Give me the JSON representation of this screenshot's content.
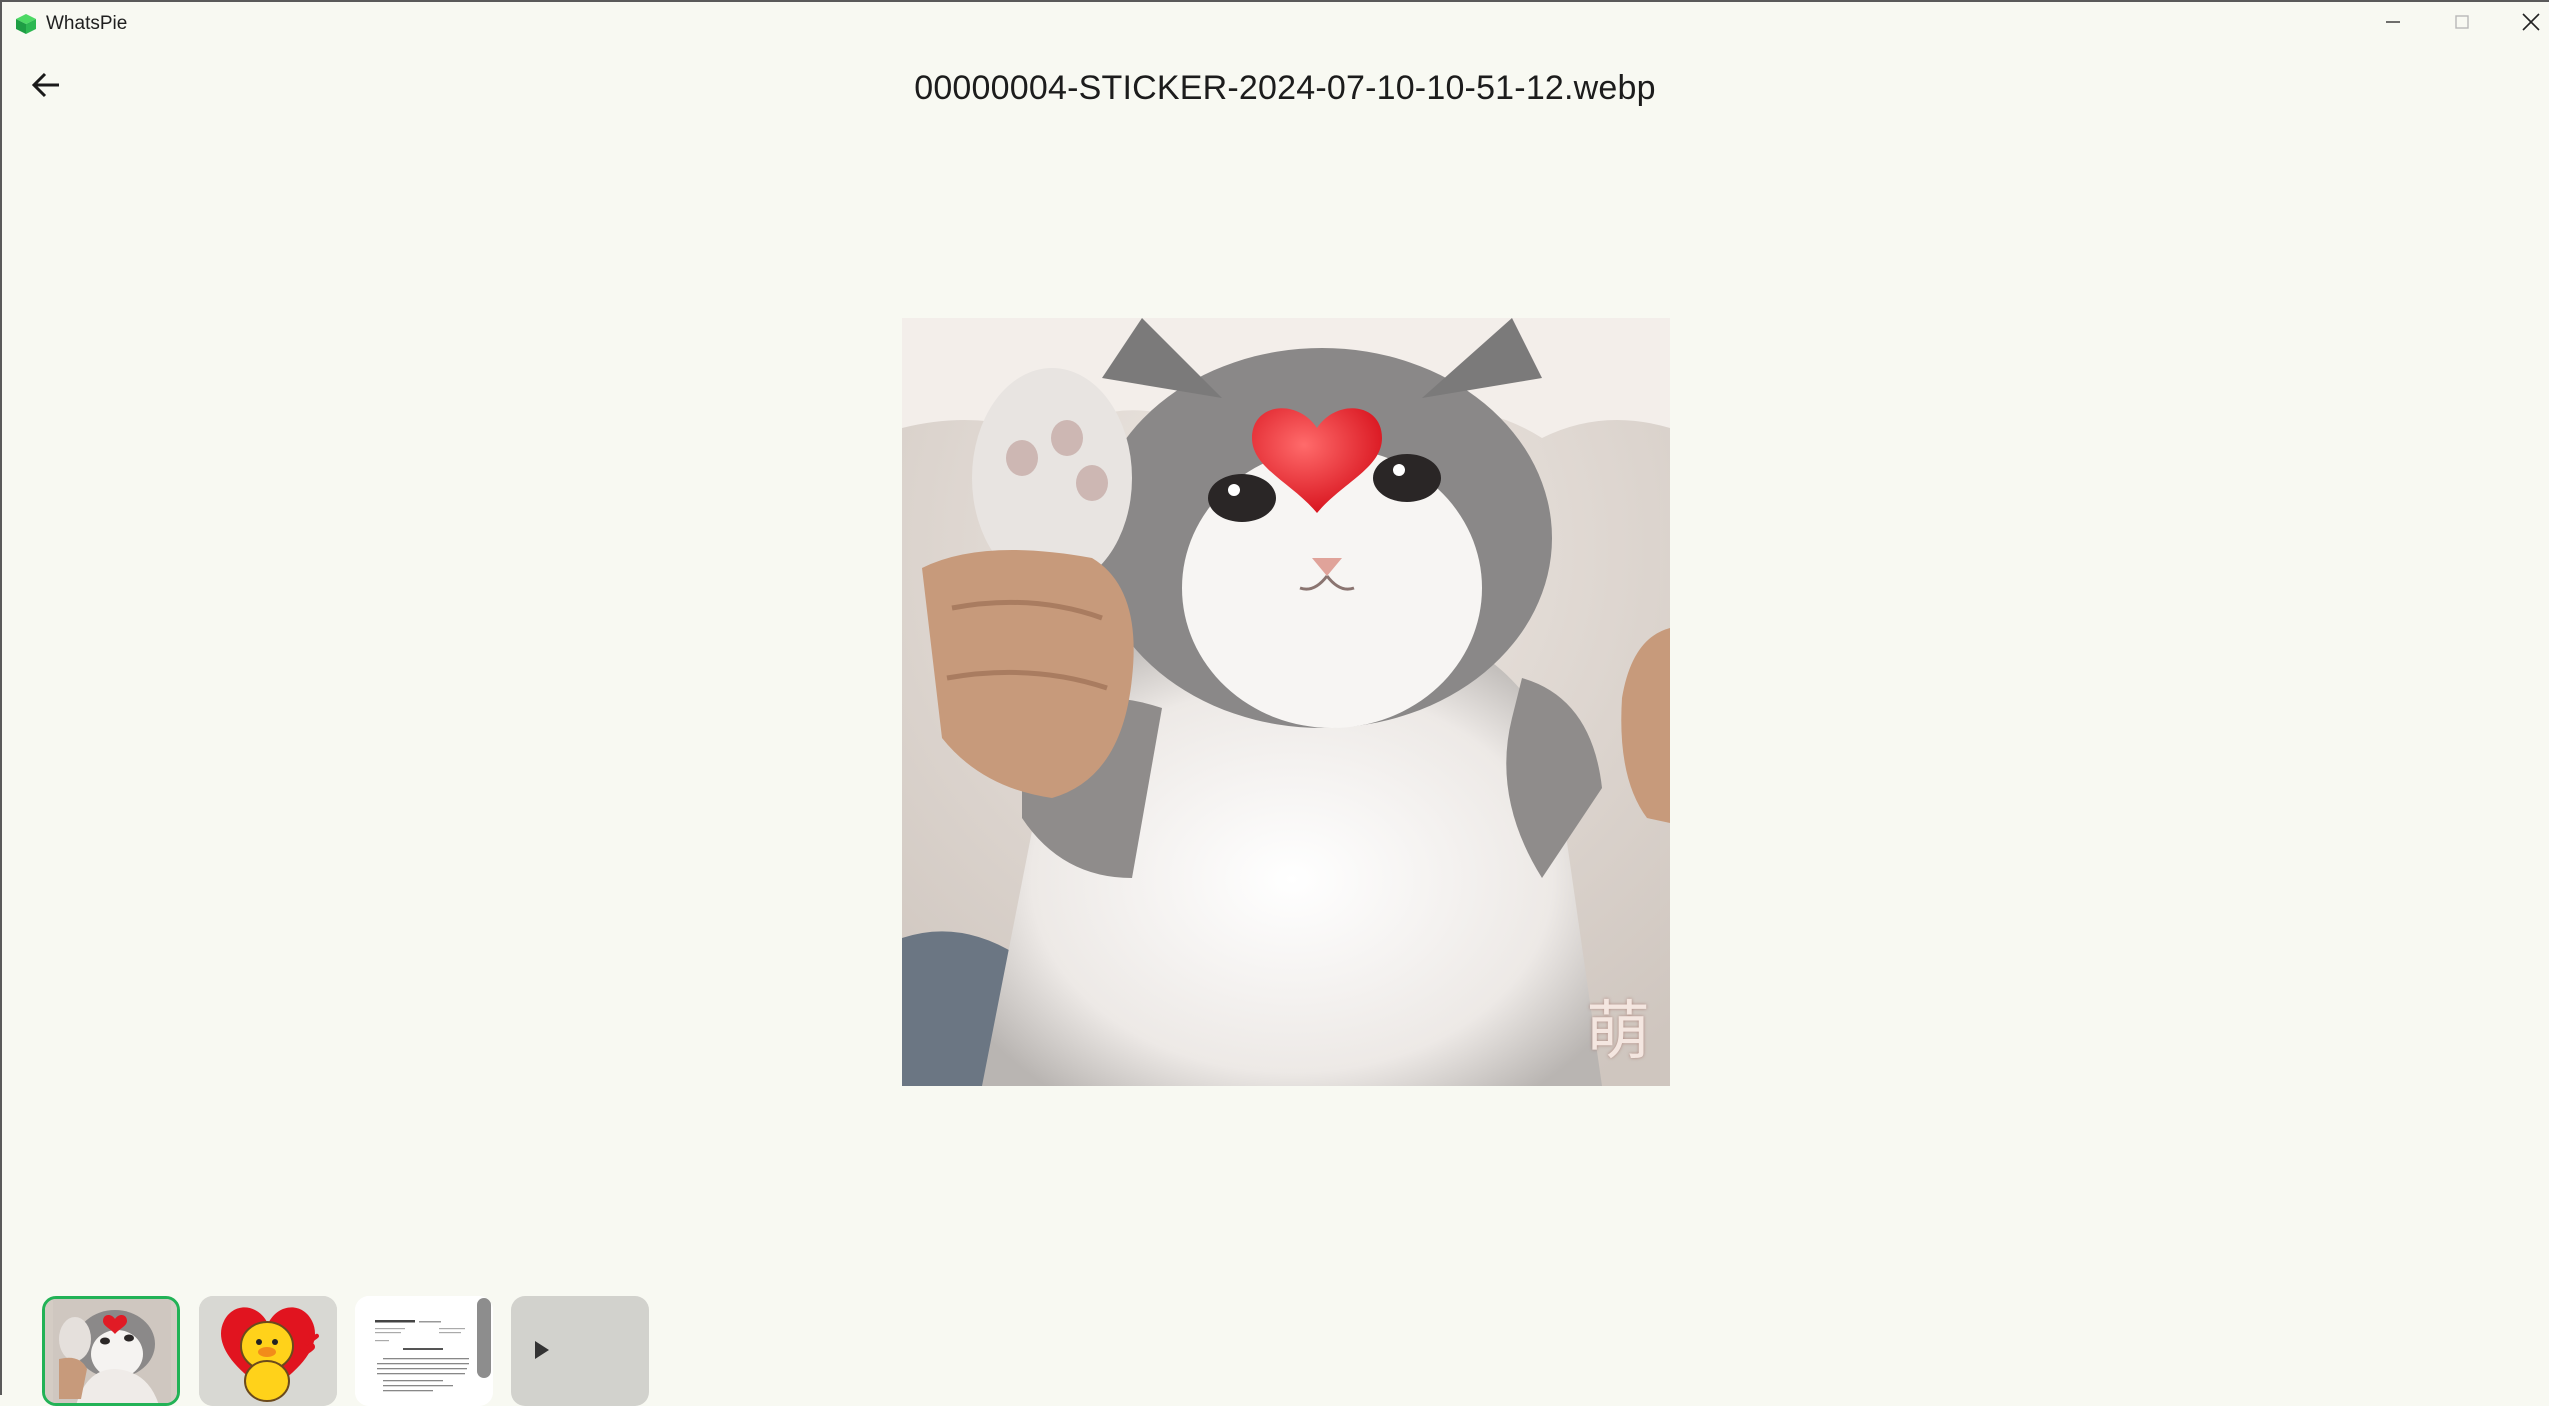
{
  "window": {
    "app_name": "WhatsPie",
    "controls": {
      "minimize": "minimize-icon",
      "maximize": "maximize-icon",
      "close": "close-icon"
    }
  },
  "header": {
    "back_icon": "arrow-left-icon",
    "file_name": "00000004-STICKER-2024-07-10-10-51-12.webp"
  },
  "viewer": {
    "image_description_icon": "cat-sticker-image",
    "watermark_text": "萌"
  },
  "thumbnails": [
    {
      "kind": "image",
      "icon": "cat-sticker-thumbnail",
      "selected": true
    },
    {
      "kind": "image",
      "icon": "duck-heart-sticker-thumbnail",
      "selected": false
    },
    {
      "kind": "document",
      "icon": "document-thumbnail",
      "selected": false
    },
    {
      "kind": "video",
      "icon": "play-icon",
      "selected": false
    }
  ],
  "colors": {
    "background": "#f8f9f2",
    "selected_border": "#22b256",
    "title_text": "#1c1c1c"
  }
}
